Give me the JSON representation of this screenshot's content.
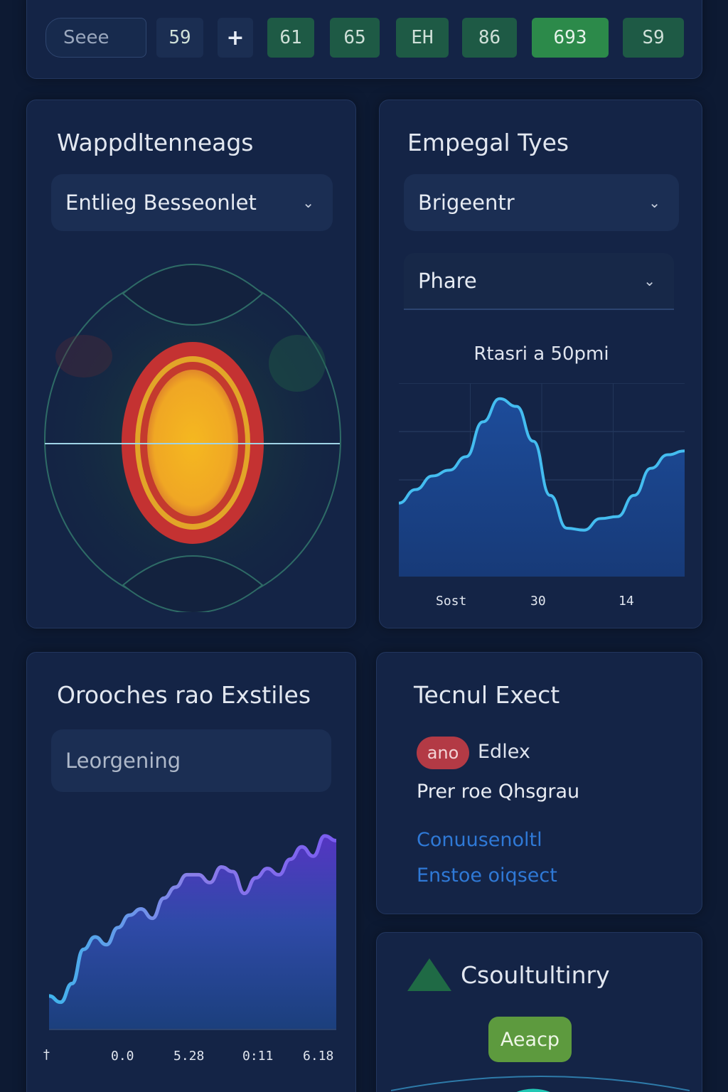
{
  "toolbar": {
    "search_placeholder": "Seee",
    "buttons": [
      {
        "label": "59"
      },
      {
        "label": "+",
        "icon": "plus-icon"
      },
      {
        "label": "61"
      },
      {
        "label": "65"
      },
      {
        "label": "EH"
      },
      {
        "label": "86"
      },
      {
        "label": "693",
        "active": true
      },
      {
        "label": "S9"
      }
    ]
  },
  "panel_wave": {
    "title": "Wappdltenneags",
    "dropdown": "Entlieg Besseonlet"
  },
  "panel_types": {
    "title": "Empegal Tyes",
    "dropdown1": "Brigeentr",
    "dropdown2": "Phare",
    "chart_caption": "Rtasri  a  50pmi"
  },
  "panel_orches": {
    "title": "Orooches rao Exstiles",
    "input_value": "Leorgening"
  },
  "panel_tecnul": {
    "title": "Tecnul Exect",
    "badge": "ano",
    "badge_label": "Edlex",
    "subtitle": "Prer roe Qhsgrau",
    "link1": "Conuusenoltl",
    "link2": "Enstoe oiqsect"
  },
  "panel_consult": {
    "title": "Csoultultinry",
    "button": "Aeacp",
    "icon": "triangle-icon"
  },
  "colors": {
    "background": "#0d1a33",
    "panel": "#142446",
    "accent_green": "#2c8a4a",
    "line_cyan": "#3fb5ec",
    "area_purple": "#5b3fc4",
    "link_blue": "#2f79d6"
  },
  "chart_data": [
    {
      "type": "line",
      "x_ticks": [
        "Sost",
        "30",
        "14"
      ],
      "series": [
        {
          "values": [
            38,
            45,
            52,
            55,
            62,
            80,
            92,
            88,
            70,
            42,
            25,
            24,
            30,
            31,
            42,
            56,
            63,
            65
          ]
        }
      ],
      "ylim": [
        0,
        100
      ],
      "grid": true
    },
    {
      "type": "area",
      "x_ticks": [
        "†",
        "0.0",
        "5.28",
        "0:11",
        "6.18"
      ],
      "series": [
        {
          "values": [
            22,
            18,
            30,
            52,
            60,
            55,
            66,
            74,
            78,
            72,
            85,
            92,
            100,
            100,
            95,
            105,
            102,
            88,
            98,
            104,
            100,
            110,
            118,
            112,
            125,
            122
          ]
        }
      ],
      "ylim": [
        0,
        140
      ],
      "grid": false
    }
  ]
}
